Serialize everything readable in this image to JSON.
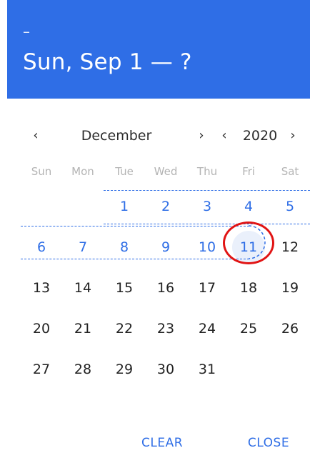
{
  "header": {
    "range_start_indicator": "–",
    "title": "Sun, Sep 1 — ?"
  },
  "nav": {
    "prev_month_icon": "‹",
    "month": "December",
    "next_month_icon": "›",
    "prev_year_icon": "‹",
    "year": "2020",
    "next_year_icon": "›"
  },
  "weekdays": [
    "Sun",
    "Mon",
    "Tue",
    "Wed",
    "Thu",
    "Fri",
    "Sat"
  ],
  "weeks": [
    [
      "",
      "",
      "1",
      "2",
      "3",
      "4",
      "5"
    ],
    [
      "6",
      "7",
      "8",
      "9",
      "10",
      "11",
      "12"
    ],
    [
      "13",
      "14",
      "15",
      "16",
      "17",
      "18",
      "19"
    ],
    [
      "20",
      "21",
      "22",
      "23",
      "24",
      "25",
      "26"
    ],
    [
      "27",
      "28",
      "29",
      "30",
      "31",
      "",
      ""
    ]
  ],
  "range_preview_days": [
    "1",
    "2",
    "3",
    "4",
    "5",
    "6",
    "7",
    "8",
    "9",
    "10",
    "11"
  ],
  "focused_day": "11",
  "actions": {
    "clear_label": "CLEAR",
    "close_label": "CLOSE"
  },
  "colors": {
    "primary": "#2f6ee6",
    "weekday_text": "#b4b4b4",
    "day_text": "#222222",
    "focused_bg": "#eaf0fb",
    "annotation_ring": "#e11414"
  },
  "icons": {
    "prev": "chevron-left-icon",
    "next": "chevron-right-icon"
  }
}
